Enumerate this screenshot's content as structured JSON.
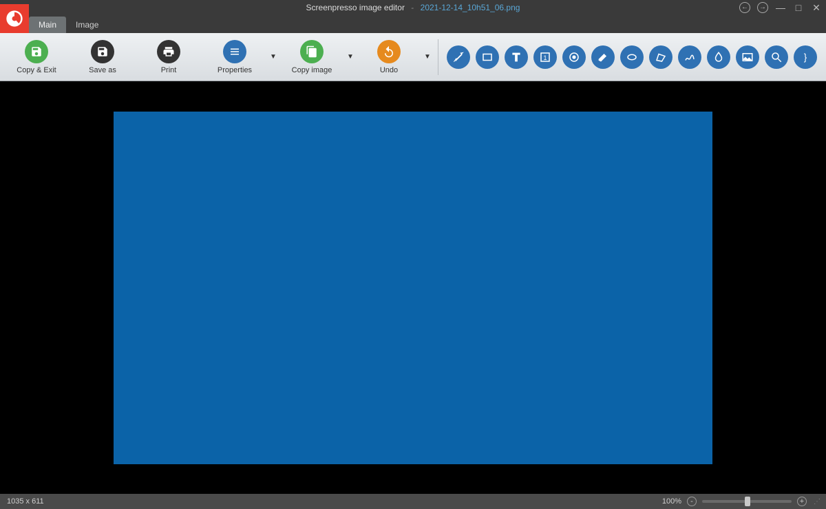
{
  "titlebar": {
    "app_title": "Screenpresso image editor",
    "separator": "-",
    "filename": "2021-12-14_10h51_06.png"
  },
  "tabs": {
    "items": [
      {
        "label": "Main",
        "active": true
      },
      {
        "label": "Image",
        "active": false
      }
    ]
  },
  "ribbon": {
    "copy_exit": "Copy & Exit",
    "save_as": "Save as",
    "print": "Print",
    "properties": "Properties",
    "copy_image": "Copy image",
    "undo": "Undo"
  },
  "tools": [
    "arrow",
    "rectangle",
    "text",
    "number-stamp",
    "target",
    "highlighter",
    "ellipse",
    "polygon",
    "freehand",
    "blur",
    "image",
    "magnifier",
    "brace"
  ],
  "status": {
    "dimensions": "1035 x 611",
    "zoom_pct": "100%"
  },
  "colors": {
    "accent_blue": "#2f71b3",
    "accent_green": "#4caf50",
    "accent_orange": "#e68a1e",
    "canvas_fill": "#0b63a8"
  }
}
